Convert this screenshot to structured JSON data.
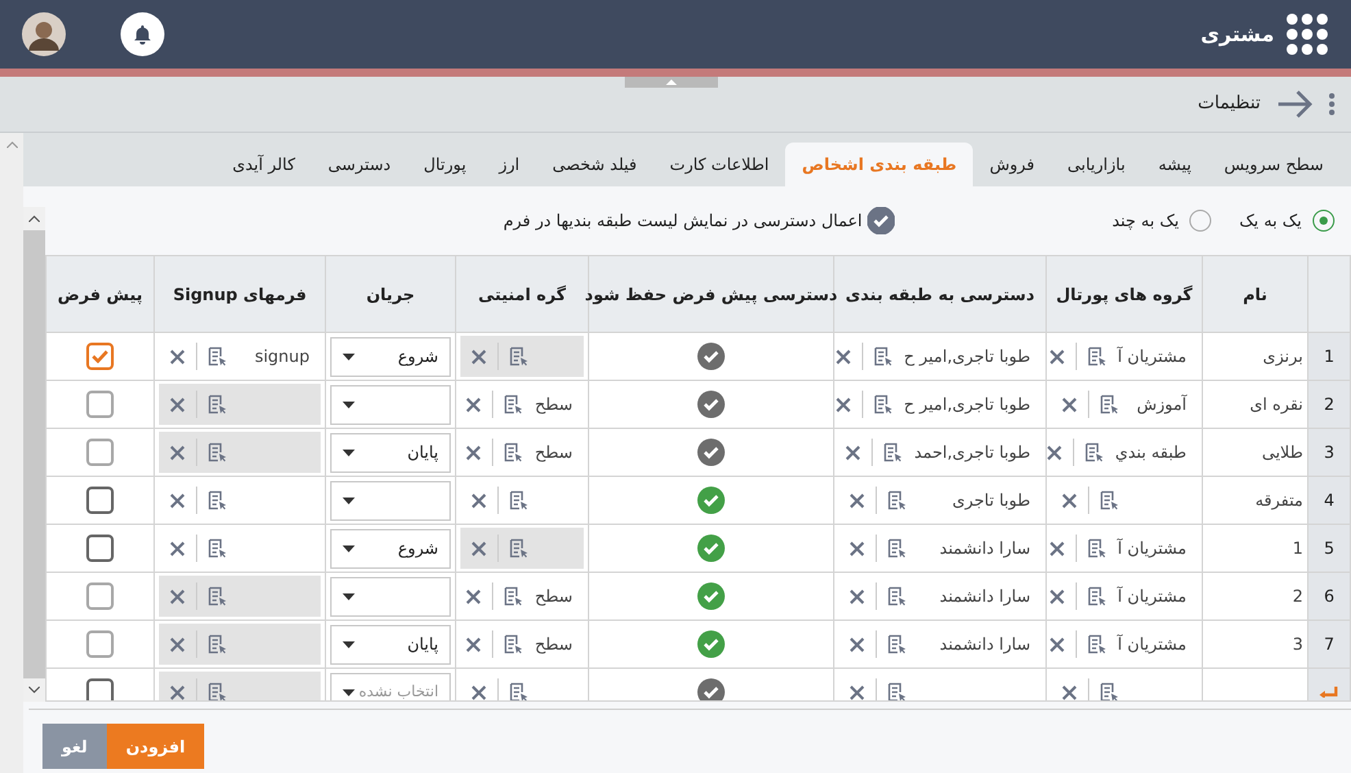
{
  "header": {
    "app_title": "مشتری"
  },
  "toolbar": {
    "title": "تنظیمات"
  },
  "tabs": [
    {
      "label": "سطح سرویس",
      "selected": false
    },
    {
      "label": "پیشه",
      "selected": false
    },
    {
      "label": "بازاریابی",
      "selected": false
    },
    {
      "label": "فروش",
      "selected": false
    },
    {
      "label": "طبقه بندی اشخاص",
      "selected": true
    },
    {
      "label": "اطلاعات کارت",
      "selected": false
    },
    {
      "label": "فیلد شخصی",
      "selected": false
    },
    {
      "label": "ارز",
      "selected": false
    },
    {
      "label": "پورتال",
      "selected": false
    },
    {
      "label": "دسترسی",
      "selected": false
    },
    {
      "label": "کالر آیدی",
      "selected": false
    }
  ],
  "mode_options": [
    {
      "label": "یک به یک",
      "selected": true
    },
    {
      "label": "یک به چند",
      "selected": false
    }
  ],
  "apply_access": {
    "label": "اعمال دسترسی در نمایش لیست طبقه بندیها در فرم",
    "checked": true
  },
  "table": {
    "columns": [
      "نام",
      "گروه های پورتال",
      "دسترسی به طبقه بندی",
      "دسترسی پیش فرض حفظ شود",
      "گره امنیتی",
      "جریان",
      "فرمهای Signup",
      "پیش فرض"
    ],
    "rows": [
      {
        "kind": "data",
        "number": "1",
        "name": "برنزی",
        "portal_group": {
          "text": "مشتریان آ"
        },
        "category_access": {
          "text": "طوبا تاجری,امیر ح"
        },
        "default_access_saved": false,
        "security_group": {
          "shaded": true
        },
        "flow": {
          "value": "شروع"
        },
        "signup_form": {
          "text": "signup",
          "shaded": false
        },
        "default": {
          "checked": true,
          "disabled": false
        }
      },
      {
        "kind": "data",
        "number": "2",
        "name": "نقره ای",
        "portal_group": {
          "text": "آموزش"
        },
        "category_access": {
          "text": "طوبا تاجری,امیر ح"
        },
        "default_access_saved": false,
        "security_group": {
          "text": "سطح",
          "shaded": false
        },
        "flow": {},
        "signup_form": {
          "shaded": true
        },
        "default": {
          "checked": false,
          "disabled": true
        }
      },
      {
        "kind": "data",
        "number": "3",
        "name": "طلایی",
        "portal_group": {
          "text": "طبقه بندي"
        },
        "category_access": {
          "text": "طوبا تاجری,احمد"
        },
        "default_access_saved": false,
        "security_group": {
          "text": "سطح",
          "shaded": false
        },
        "flow": {
          "value": "پایان"
        },
        "signup_form": {
          "shaded": true
        },
        "default": {
          "checked": false,
          "disabled": true
        }
      },
      {
        "kind": "data",
        "number": "4",
        "name": "متفرقه",
        "portal_group": {},
        "category_access": {
          "text": "طوبا تاجری"
        },
        "default_access_saved": true,
        "security_group": {
          "shaded": false
        },
        "flow": {},
        "signup_form": {
          "shaded": false
        },
        "default": {
          "checked": false,
          "disabled": false
        }
      },
      {
        "kind": "data",
        "number": "5",
        "name": "1",
        "portal_group": {
          "text": "مشتریان آ"
        },
        "category_access": {
          "text": "سارا دانشمند"
        },
        "default_access_saved": true,
        "security_group": {
          "shaded": true
        },
        "flow": {
          "value": "شروع"
        },
        "signup_form": {
          "shaded": false
        },
        "default": {
          "checked": false,
          "disabled": false
        }
      },
      {
        "kind": "data",
        "number": "6",
        "name": "2",
        "portal_group": {
          "text": "مشتریان آ"
        },
        "category_access": {
          "text": "سارا دانشمند"
        },
        "default_access_saved": true,
        "security_group": {
          "text": "سطح",
          "shaded": false
        },
        "flow": {},
        "signup_form": {
          "shaded": true
        },
        "default": {
          "checked": false,
          "disabled": true
        }
      },
      {
        "kind": "data",
        "number": "7",
        "name": "3",
        "portal_group": {
          "text": "مشتریان آ"
        },
        "category_access": {
          "text": "سارا دانشمند"
        },
        "default_access_saved": true,
        "security_group": {
          "text": "سطح",
          "shaded": false
        },
        "flow": {
          "value": "پایان"
        },
        "signup_form": {
          "shaded": true
        },
        "default": {
          "checked": false,
          "disabled": true
        }
      },
      {
        "kind": "new",
        "portal_group": {},
        "category_access": {},
        "default_access_saved": false,
        "security_group": {
          "shaded": false
        },
        "flow": {
          "placeholder": "انتخاب نشده"
        },
        "signup_form": {
          "shaded": true
        },
        "default": {
          "checked": false,
          "disabled": false
        }
      }
    ]
  },
  "buttons": [
    {
      "label": "افزودن",
      "kind": "primary"
    },
    {
      "label": "لغو",
      "kind": "secondary"
    }
  ]
}
